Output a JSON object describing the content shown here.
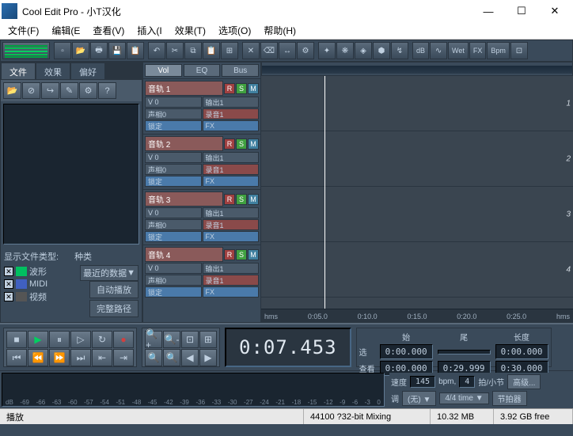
{
  "title": "Cool Edit Pro  - 小T汉化",
  "win_buttons": {
    "min": "—",
    "max": "☐",
    "close": "✕"
  },
  "menu": [
    "文件(F)",
    "编辑(E",
    "查看(V)",
    "插入(I",
    "效果(T)",
    "选项(O)",
    "帮助(H)"
  ],
  "toolbar2_labels": {
    "db": "dB",
    "wet": "Wet",
    "fx": "FX",
    "bpm": "Bpm"
  },
  "left_tabs": [
    "文件",
    "效果",
    "偏好"
  ],
  "file_type": {
    "header_show": "显示文件类型:",
    "header_kind": "种类",
    "waveform": "波形",
    "midi": "MIDI",
    "video": "视频",
    "recent": "最近的数据",
    "autoplay": "自动播放",
    "fullpath": "完整路径"
  },
  "mixer_tabs": [
    "Vol",
    "EQ",
    "Bus"
  ],
  "tracks": [
    {
      "name": "音轨 1",
      "vol": "V 0",
      "out": "输出1",
      "pan": "声相0",
      "rec": "录音1",
      "lock": "锁定",
      "fx": "FX"
    },
    {
      "name": "音轨 2",
      "vol": "V 0",
      "out": "输出1",
      "pan": "声相0",
      "rec": "录音1",
      "lock": "锁定",
      "fx": "FX"
    },
    {
      "name": "音轨 3",
      "vol": "V 0",
      "out": "输出1",
      "pan": "声相0",
      "rec": "录音1",
      "lock": "锁定",
      "fx": "FX"
    },
    {
      "name": "音轨 4",
      "vol": "V 0",
      "out": "输出1",
      "pan": "声相0",
      "rec": "录音1",
      "lock": "锁定",
      "fx": "FX"
    }
  ],
  "rsm": {
    "r": "R",
    "s": "S",
    "m": "M"
  },
  "track_nums": [
    "1",
    "2",
    "3",
    "4"
  ],
  "ruler_bottom": {
    "unit_l": "hms",
    "t1": "0:05.0",
    "t2": "0:10.0",
    "t3": "0:15.0",
    "t4": "0:20.0",
    "t5": "0:25.0",
    "unit_r": "hms"
  },
  "time_display": "0:07.453",
  "selection": {
    "hdr_begin": "始",
    "hdr_end": "尾",
    "hdr_len": "长度",
    "sel_label": "选",
    "sel_begin": "0:00.000",
    "sel_end": "",
    "sel_len": "0:00.000",
    "view_label": "查看",
    "view_begin": "0:00.000",
    "view_end": "0:29.999",
    "view_len": "0:30.000"
  },
  "tempo": {
    "speed_label": "速度",
    "bpm": "145",
    "bpm_unit": "bpm,",
    "beats": "4",
    "beats_label": "拍/小节",
    "advanced": "高级...",
    "key_label": "调",
    "key_val": "(无)",
    "timesig": "4/4 time",
    "metronome": "节拍器"
  },
  "meter_db": [
    "dB",
    "-69",
    "-66",
    "-63",
    "-60",
    "-57",
    "-54",
    "-51",
    "-48",
    "-45",
    "-42",
    "-39",
    "-36",
    "-33",
    "-30",
    "-27",
    "-24",
    "-21",
    "-18",
    "-15",
    "-12",
    "-9",
    "-6",
    "-3",
    "0"
  ],
  "status": {
    "play": "播放",
    "format": "44100 ?32-bit Mixing",
    "size": "10.32 MB",
    "free": "3.92 GB free"
  },
  "dropdown_arrow": "▼"
}
